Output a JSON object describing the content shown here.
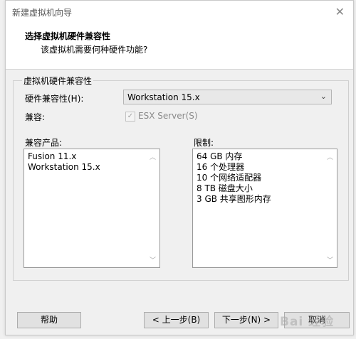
{
  "window": {
    "title": "新建虚拟机向导"
  },
  "header": {
    "title": "选择虚拟机硬件兼容性",
    "subtitle": "该虚拟机需要何种硬件功能?"
  },
  "group": {
    "title": "虚拟机硬件兼容性",
    "hw_label": "硬件兼容性(H):",
    "hw_value": "Workstation 15.x",
    "compat_label": "兼容:",
    "esx_label": "ESX Server(S)",
    "products_label": "兼容产品:",
    "products": [
      "Fusion 11.x",
      "Workstation 15.x"
    ],
    "limits_label": "限制:",
    "limits": [
      "64 GB 内存",
      "16 个处理器",
      "10 个网络适配器",
      "8 TB 磁盘大小",
      "3 GB 共享图形内存"
    ]
  },
  "buttons": {
    "help": "帮助",
    "back": "< 上一步(B)",
    "next": "下一步(N) >",
    "cancel": "取消"
  },
  "watermark": "Bai 经验"
}
